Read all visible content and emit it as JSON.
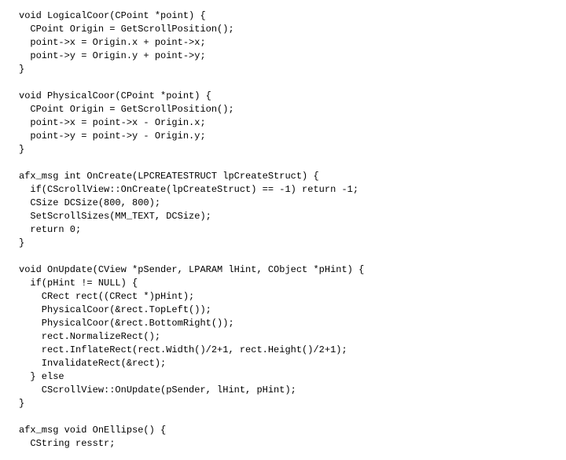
{
  "code": {
    "lines": [
      "void LogicalCoor(CPoint *point) {",
      "  CPoint Origin = GetScrollPosition();",
      "  point->x = Origin.x + point->x;",
      "  point->y = Origin.y + point->y;",
      "}",
      "",
      "void PhysicalCoor(CPoint *point) {",
      "  CPoint Origin = GetScrollPosition();",
      "  point->x = point->x - Origin.x;",
      "  point->y = point->y - Origin.y;",
      "}",
      "",
      "afx_msg int OnCreate(LPCREATESTRUCT lpCreateStruct) {",
      "  if(CScrollView::OnCreate(lpCreateStruct) == -1) return -1;",
      "  CSize DCSize(800, 800);",
      "  SetScrollSizes(MM_TEXT, DCSize);",
      "  return 0;",
      "}",
      "",
      "void OnUpdate(CView *pSender, LPARAM lHint, CObject *pHint) {",
      "  if(pHint != NULL) {",
      "    CRect rect((CRect *)pHint);",
      "    PhysicalCoor(&rect.TopLeft());",
      "    PhysicalCoor(&rect.BottomRight());",
      "    rect.NormalizeRect();",
      "    rect.InflateRect(rect.Width()/2+1, rect.Height()/2+1);",
      "    InvalidateRect(&rect);",
      "  } else",
      "    CScrollView::OnUpdate(pSender, lHint, pHint);",
      "}",
      "",
      "afx_msg void OnEllipse() {",
      "  CString resstr;"
    ]
  }
}
